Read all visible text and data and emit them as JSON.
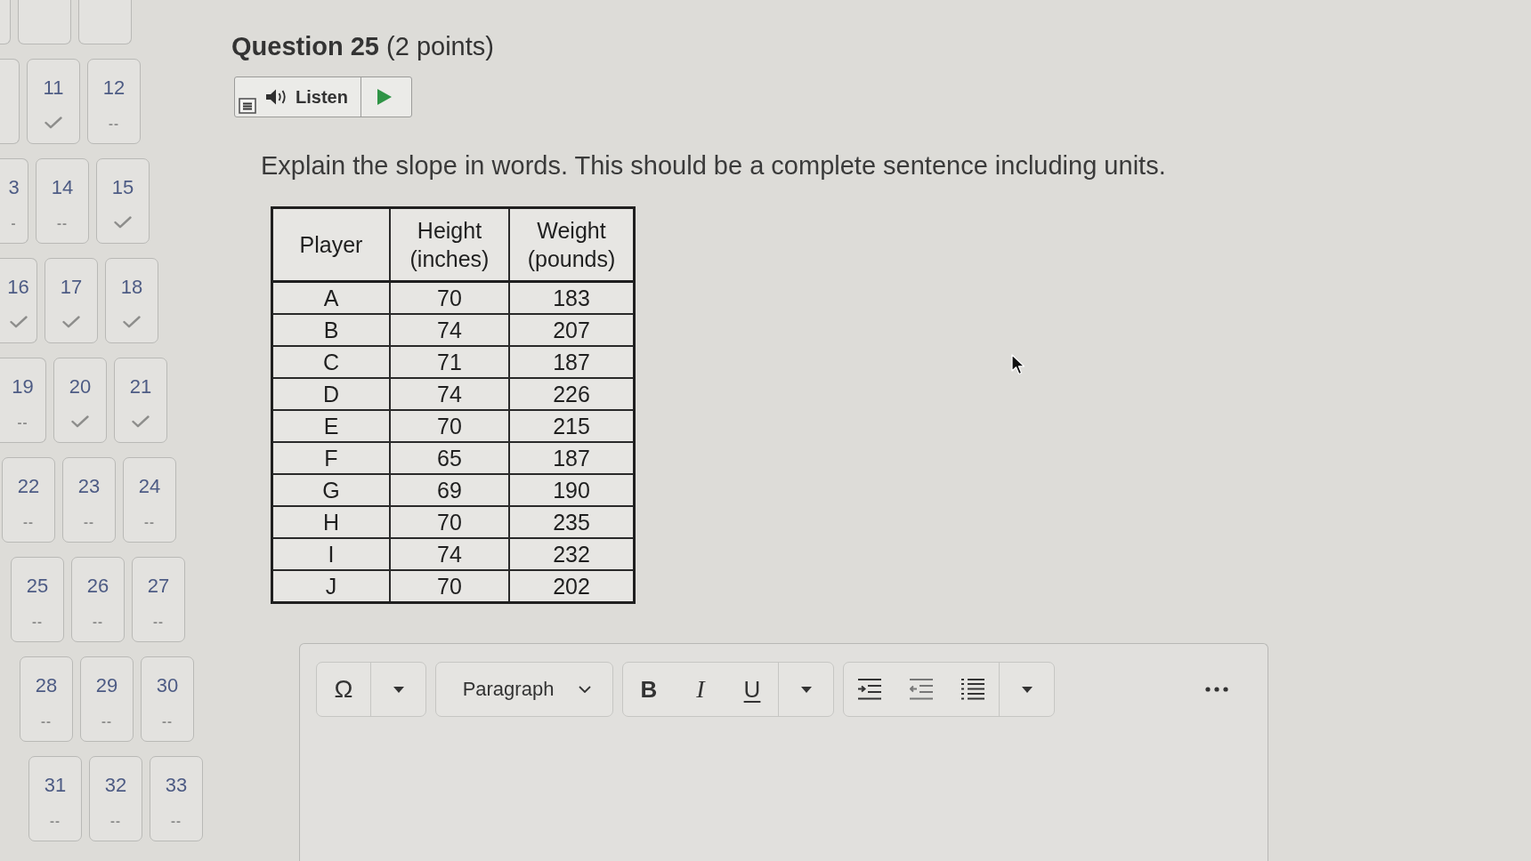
{
  "question_nav": {
    "rows": [
      {
        "tiles": [
          {
            "answered": false
          },
          {
            "answered": false
          },
          {
            "answered": false
          }
        ]
      },
      {
        "tiles": [
          {
            "answered": false
          },
          {
            "number": "11",
            "answered": true
          },
          {
            "number": "12",
            "answered": false,
            "status_text": "--"
          }
        ]
      },
      {
        "tiles": [
          {
            "number": "3",
            "answered": false,
            "status_text": "-"
          },
          {
            "number": "14",
            "answered": false,
            "status_text": "--"
          },
          {
            "number": "15",
            "answered": true
          }
        ]
      },
      {
        "tiles": [
          {
            "number": "16",
            "answered": true
          },
          {
            "number": "17",
            "answered": true
          },
          {
            "number": "18",
            "answered": true
          }
        ]
      },
      {
        "tiles": [
          {
            "number": "19",
            "answered": false,
            "status_text": "--"
          },
          {
            "number": "20",
            "answered": true
          },
          {
            "number": "21",
            "answered": true
          }
        ]
      },
      {
        "tiles": [
          {
            "number": "22",
            "answered": false,
            "status_text": "--"
          },
          {
            "number": "23",
            "answered": false,
            "status_text": "--"
          },
          {
            "number": "24",
            "answered": false,
            "status_text": "--"
          }
        ]
      },
      {
        "tiles": [
          {
            "number": "25",
            "answered": false,
            "status_text": "--"
          },
          {
            "number": "26",
            "answered": false,
            "status_text": "--"
          },
          {
            "number": "27",
            "answered": false,
            "status_text": "--"
          }
        ]
      },
      {
        "tiles": [
          {
            "number": "28",
            "answered": false,
            "status_text": "--"
          },
          {
            "number": "29",
            "answered": false,
            "status_text": "--"
          },
          {
            "number": "30",
            "answered": false,
            "status_text": "--"
          }
        ]
      },
      {
        "tiles": [
          {
            "number": "31",
            "answered": false,
            "status_text": "--"
          },
          {
            "number": "32",
            "answered": false,
            "status_text": "--"
          },
          {
            "number": "33",
            "answered": false,
            "status_text": "--"
          }
        ]
      }
    ]
  },
  "question": {
    "title": "**Question 25** (2 points)",
    "listen": {
      "label": "Listen"
    },
    "prompt": "Explain the slope in words. This should be a complete sentence including units."
  },
  "table": {
    "columns": [
      "Player",
      "Height (inches)",
      "Weight (pounds)"
    ],
    "rows": [
      [
        "A",
        "70",
        "183"
      ],
      [
        "B",
        "74",
        "207"
      ],
      [
        "C",
        "71",
        "187"
      ],
      [
        "D",
        "74",
        "226"
      ],
      [
        "E",
        "70",
        "215"
      ],
      [
        "F",
        "65",
        "187"
      ],
      [
        "G",
        "69",
        "190"
      ],
      [
        "H",
        "70",
        "235"
      ],
      [
        "I",
        "74",
        "232"
      ],
      [
        "J",
        "70",
        "202"
      ]
    ]
  },
  "editor": {
    "toolbar": [
      {
        "items": [
          {
            "kind": "symbol",
            "label": "Ω"
          },
          {
            "kind": "caret"
          }
        ]
      },
      {
        "items": [
          {
            "kind": "dropdown",
            "label": "Paragraph"
          }
        ]
      },
      {
        "items": [
          {
            "kind": "bold",
            "label": "B"
          },
          {
            "kind": "italic",
            "label": "I"
          },
          {
            "kind": "underline",
            "label": "U"
          },
          {
            "kind": "caret"
          }
        ]
      },
      {
        "items": [
          {
            "kind": "indent"
          },
          {
            "kind": "outdent"
          },
          {
            "kind": "list"
          },
          {
            "kind": "caret"
          }
        ]
      }
    ]
  }
}
